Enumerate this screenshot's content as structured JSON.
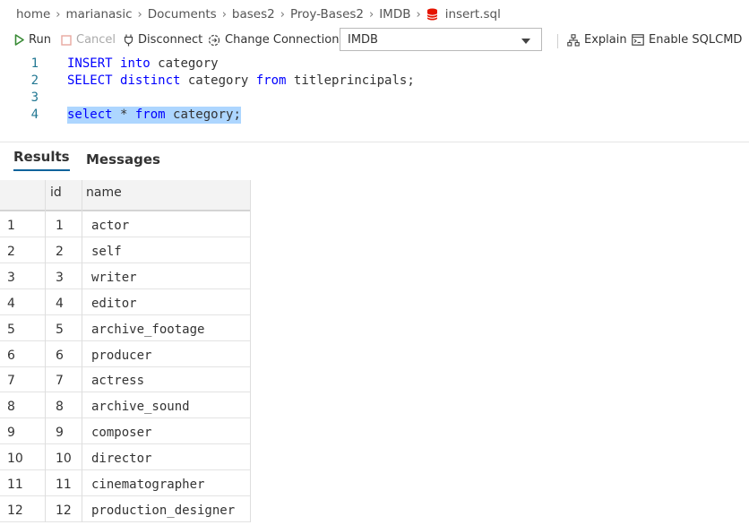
{
  "breadcrumb": [
    "home",
    "marianasic",
    "Documents",
    "bases2",
    "Proy-Bases2",
    "IMDB",
    "insert.sql"
  ],
  "toolbar": {
    "run": "Run",
    "cancel": "Cancel",
    "disconnect": "Disconnect",
    "change_connection": "Change Connection",
    "database": "IMDB",
    "explain": "Explain",
    "enable_sqlcmd": "Enable SQLCMD"
  },
  "editor": {
    "lines": [
      {
        "num": "1",
        "tokens": [
          {
            "t": "INSERT",
            "kw": true
          },
          {
            "t": " "
          },
          {
            "t": "into",
            "kw": true
          },
          {
            "t": " category"
          }
        ]
      },
      {
        "num": "2",
        "tokens": [
          {
            "t": "SELECT",
            "kw": true
          },
          {
            "t": " "
          },
          {
            "t": "distinct",
            "kw": true
          },
          {
            "t": " category "
          },
          {
            "t": "from",
            "kw": true
          },
          {
            "t": " titleprincipals;"
          }
        ]
      },
      {
        "num": "3",
        "tokens": []
      },
      {
        "num": "4",
        "tokens": [
          {
            "t": "select",
            "kw": true
          },
          {
            "t": " * "
          },
          {
            "t": "from",
            "kw": true
          },
          {
            "t": " category;"
          }
        ],
        "selected": true
      }
    ]
  },
  "results_tabs": [
    "Results",
    "Messages"
  ],
  "grid": {
    "columns": [
      "id",
      "name"
    ],
    "rows": [
      [
        "1",
        "1",
        "actor"
      ],
      [
        "2",
        "2",
        "self"
      ],
      [
        "3",
        "3",
        "writer"
      ],
      [
        "4",
        "4",
        "editor"
      ],
      [
        "5",
        "5",
        "archive_footage"
      ],
      [
        "6",
        "6",
        "producer"
      ],
      [
        "7",
        "7",
        "actress"
      ],
      [
        "8",
        "8",
        "archive_sound"
      ],
      [
        "9",
        "9",
        "composer"
      ],
      [
        "10",
        "10",
        "director"
      ],
      [
        "11",
        "11",
        "cinematographer"
      ],
      [
        "12",
        "12",
        "production_designer"
      ]
    ]
  },
  "colors": {
    "keyword": "#0000ff",
    "line_number": "#237893",
    "selection": "#add6ff",
    "run_icon": "#388a34",
    "db_icon": "#e51400"
  }
}
